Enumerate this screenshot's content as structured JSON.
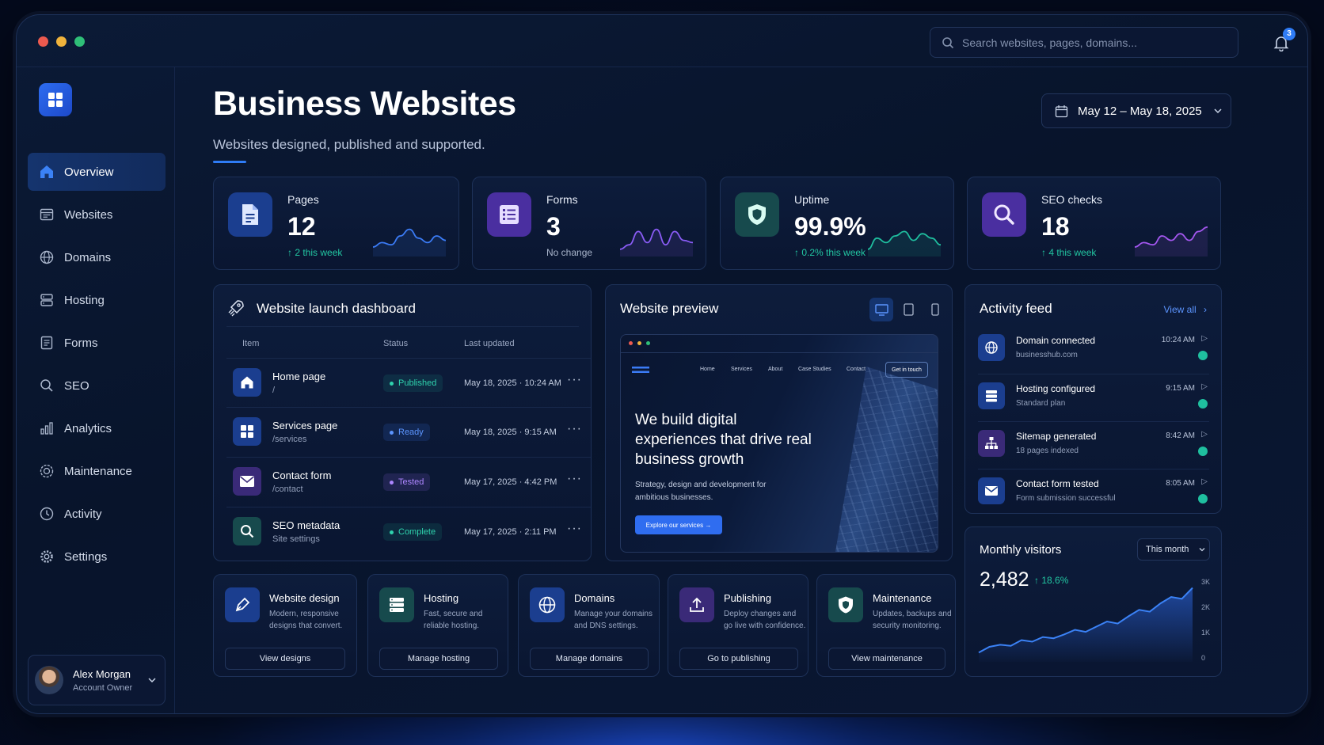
{
  "window": {
    "dot_colors": [
      "#ec5a4f",
      "#f0b33c",
      "#2fbf78"
    ]
  },
  "search": {
    "placeholder": "Search websites, pages, domains..."
  },
  "notifications": {
    "count": "3"
  },
  "sidebar": {
    "items": [
      {
        "label": "Overview",
        "icon": "home-icon",
        "active": true
      },
      {
        "label": "Websites",
        "icon": "browser-icon"
      },
      {
        "label": "Domains",
        "icon": "globe-icon"
      },
      {
        "label": "Hosting",
        "icon": "server-icon"
      },
      {
        "label": "Forms",
        "icon": "form-icon"
      },
      {
        "label": "SEO",
        "icon": "search-icon"
      },
      {
        "label": "Analytics",
        "icon": "bar-chart-icon"
      },
      {
        "label": "Maintenance",
        "icon": "gear-check-icon"
      },
      {
        "label": "Activity",
        "icon": "clock-icon"
      },
      {
        "label": "Settings",
        "icon": "gear-icon"
      }
    ],
    "user": {
      "name": "Alex Morgan",
      "role": "Account Owner"
    }
  },
  "header": {
    "title": "Business Websites",
    "subtitle": "Websites designed, published and supported.",
    "date_range": "May 12 – May 18, 2025"
  },
  "stats": [
    {
      "label": "Pages",
      "value": "12",
      "delta": "↑ 2 this week",
      "icon": "document-icon",
      "color": "#3b7bf5",
      "spark": [
        20,
        16,
        18,
        10,
        4,
        12,
        16,
        10,
        14
      ]
    },
    {
      "label": "Forms",
      "value": "3",
      "delta": "No change",
      "icon": "list-icon",
      "color": "#8a5cf6",
      "spark": [
        22,
        18,
        6,
        16,
        4,
        18,
        6,
        14,
        16
      ]
    },
    {
      "label": "Uptime",
      "value": "99.9%",
      "delta": "↑ 0.2% this week",
      "icon": "shield-icon",
      "color": "#1fbf9f",
      "spark": [
        22,
        12,
        16,
        10,
        6,
        14,
        8,
        12,
        18
      ]
    },
    {
      "label": "SEO checks",
      "value": "18",
      "delta": "↑ 4 this week",
      "icon": "magnifier-icon",
      "color": "#a457f0",
      "spark": [
        20,
        16,
        18,
        10,
        14,
        8,
        14,
        6,
        2
      ]
    }
  ],
  "launch": {
    "title": "Website launch dashboard",
    "columns": [
      "Item",
      "Status",
      "Last updated"
    ],
    "rows": [
      {
        "name": "Home page",
        "path": "/",
        "status": "Published",
        "status_color": "#1fbf9f",
        "date": "May 18, 2025  ·  10:24 AM",
        "icon": "home-icon",
        "icon_bg": "#1b3e8f"
      },
      {
        "name": "Services page",
        "path": "/services",
        "status": "Ready",
        "status_color": "#3b7bf5",
        "date": "May 18, 2025  ·  9:15 AM",
        "icon": "grid-icon",
        "icon_bg": "#1b3e8f"
      },
      {
        "name": "Contact form",
        "path": "/contact",
        "status": "Tested",
        "status_color": "#9a6cf8",
        "date": "May 17, 2025  ·  4:42 PM",
        "icon": "mail-icon",
        "icon_bg": "#3a2a78"
      },
      {
        "name": "SEO metadata",
        "path": "Site settings",
        "status": "Complete",
        "status_color": "#1fbf9f",
        "date": "May 17, 2025  ·  2:11 PM",
        "icon": "search-icon",
        "icon_bg": "#174a4d"
      }
    ],
    "more": "···"
  },
  "preview": {
    "title": "Website preview",
    "nav": [
      "Home",
      "Services",
      "About",
      "Case Studies",
      "Contact"
    ],
    "cta_top": "Get in touch",
    "headline": "We build digital experiences that drive real business growth",
    "body": "Strategy, design and development for ambitious businesses.",
    "button": "Explore our services →"
  },
  "activity": {
    "title": "Activity feed",
    "view_all": "View all",
    "items": [
      {
        "title": "Domain connected",
        "sub": "businesshub.com",
        "time": "10:24 AM",
        "icon": "globe-icon",
        "icon_bg": "#1b3e8f"
      },
      {
        "title": "Hosting configured",
        "sub": "Standard plan",
        "time": "9:15 AM",
        "icon": "server-icon",
        "icon_bg": "#1b3e8f"
      },
      {
        "title": "Sitemap generated",
        "sub": "18 pages indexed",
        "time": "8:42 AM",
        "icon": "sitemap-icon",
        "icon_bg": "#3a2a78"
      },
      {
        "title": "Contact form tested",
        "sub": "Form submission successful",
        "time": "8:05 AM",
        "icon": "mail-icon",
        "icon_bg": "#1b3e8f"
      }
    ]
  },
  "visitors": {
    "title": "Monthly visitors",
    "period": "This month",
    "value": "2,482",
    "delta": "↑ 18.6%",
    "y_ticks": [
      "3K",
      "2K",
      "1K",
      "0"
    ]
  },
  "chart_data": {
    "type": "area",
    "title": "Monthly visitors",
    "ylim": [
      0,
      3000
    ],
    "y_ticks": [
      "3K",
      "2K",
      "1K",
      "0"
    ],
    "series": [
      {
        "values": [
          300,
          520,
          600,
          560,
          780,
          720,
          900,
          850,
          1000,
          1180,
          1100,
          1300,
          1500,
          1420,
          1700,
          1950,
          1880,
          2200,
          2450,
          2380,
          2800
        ]
      }
    ]
  },
  "services": [
    {
      "title": "Website design",
      "desc": "Modern, responsive designs that convert.",
      "button": "View designs",
      "icon": "pen-icon",
      "icon_bg": "#1b3e8f"
    },
    {
      "title": "Hosting",
      "desc": "Fast, secure and reliable hosting.",
      "button": "Manage hosting",
      "icon": "server-icon",
      "icon_bg": "#174a4d"
    },
    {
      "title": "Domains",
      "desc": "Manage your domains and DNS settings.",
      "button": "Manage domains",
      "icon": "globe-icon",
      "icon_bg": "#1b3e8f"
    },
    {
      "title": "Publishing",
      "desc": "Deploy changes and go live with confidence.",
      "button": "Go to publishing",
      "icon": "upload-icon",
      "icon_bg": "#3a2a78"
    },
    {
      "title": "Maintenance",
      "desc": "Updates, backups and security monitoring.",
      "button": "View maintenance",
      "icon": "shield-icon",
      "icon_bg": "#174a4d"
    }
  ]
}
